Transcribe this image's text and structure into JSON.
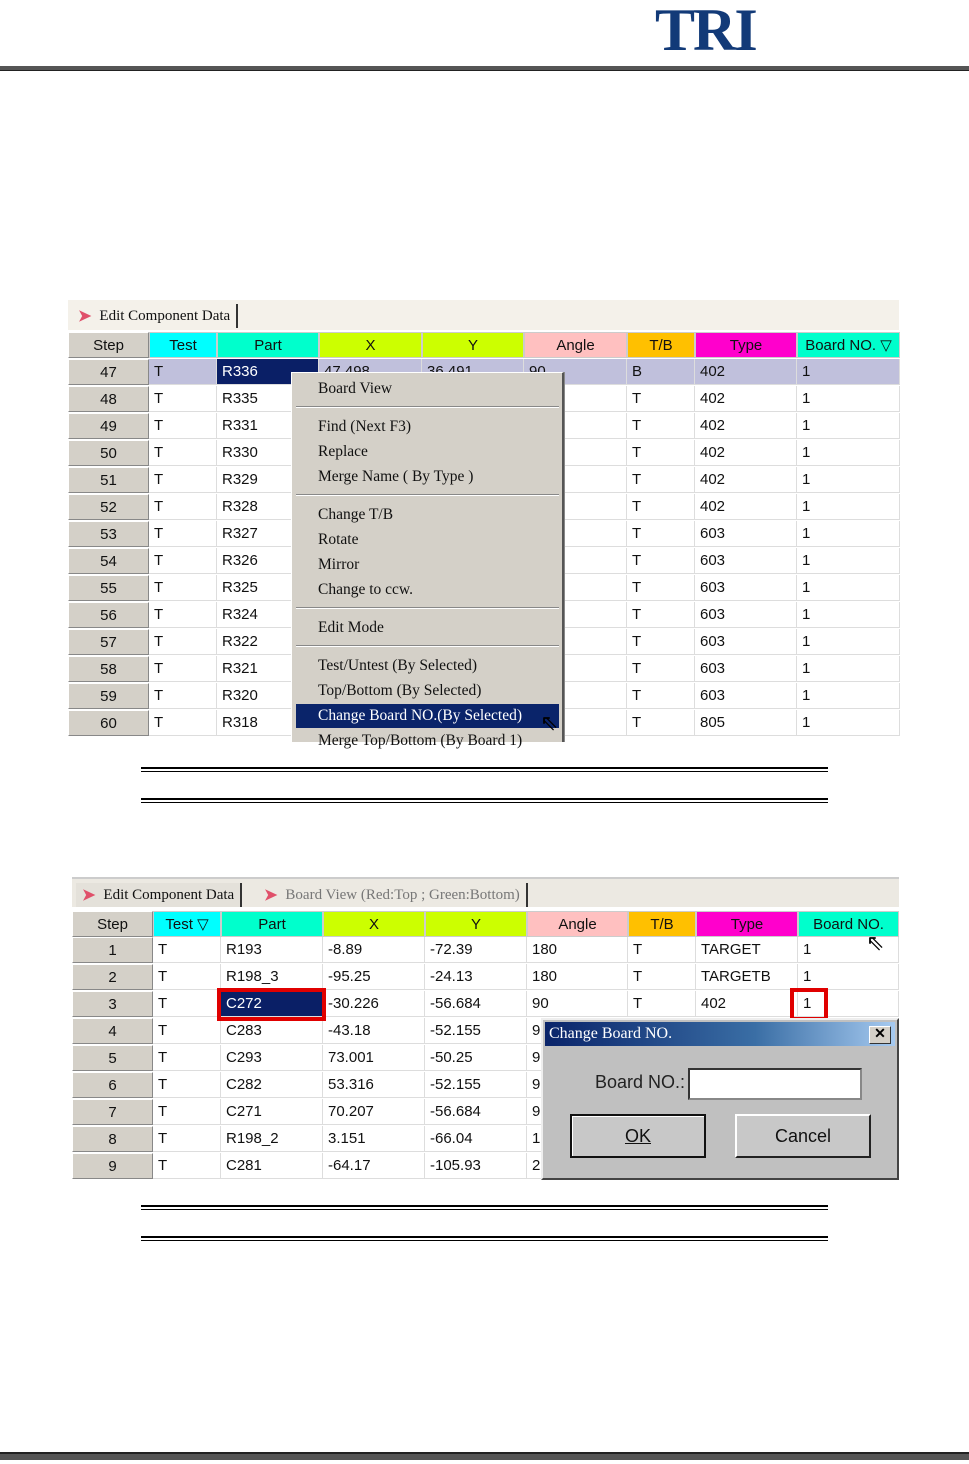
{
  "logo": "TRI",
  "table1": {
    "tabs": [
      "Edit Component Data"
    ],
    "headers": [
      "Step",
      "Test",
      "Part",
      "X",
      "Y",
      "Angle",
      "T/B",
      "Type",
      "Board NO."
    ],
    "header_colors": [
      "#d4d0c8",
      "#00ffff",
      "#00ffcc",
      "#ccff00",
      "#ccff00",
      "#ffc0c0",
      "#ffc000",
      "#ff00cc",
      "#00ffcc"
    ],
    "sort_icon": "triangle-down-icon",
    "rows": [
      [
        "47",
        "T",
        "R336",
        "47.498",
        "36.491",
        "90",
        "B",
        "402",
        "1"
      ],
      [
        "48",
        "T",
        "R335",
        "",
        "",
        "",
        "T",
        "402",
        "1"
      ],
      [
        "49",
        "T",
        "R331",
        "",
        "",
        "",
        "T",
        "402",
        "1"
      ],
      [
        "50",
        "T",
        "R330",
        "",
        "",
        "",
        "T",
        "402",
        "1"
      ],
      [
        "51",
        "T",
        "R329",
        "",
        "",
        "",
        "T",
        "402",
        "1"
      ],
      [
        "52",
        "T",
        "R328",
        "",
        "",
        "",
        "T",
        "402",
        "1"
      ],
      [
        "53",
        "T",
        "R327",
        "",
        "",
        "",
        "T",
        "603",
        "1"
      ],
      [
        "54",
        "T",
        "R326",
        "",
        "",
        "",
        "T",
        "603",
        "1"
      ],
      [
        "55",
        "T",
        "R325",
        "",
        "",
        "",
        "T",
        "603",
        "1"
      ],
      [
        "56",
        "T",
        "R324",
        "",
        "",
        "",
        "T",
        "603",
        "1"
      ],
      [
        "57",
        "T",
        "R322",
        "",
        "",
        "",
        "T",
        "603",
        "1"
      ],
      [
        "58",
        "T",
        "R321",
        "",
        "",
        "",
        "T",
        "603",
        "1"
      ],
      [
        "59",
        "T",
        "R320",
        "",
        "",
        "",
        "T",
        "603",
        "1"
      ],
      [
        "60",
        "T",
        "R318",
        "",
        "",
        "",
        "T",
        "805",
        "1"
      ]
    ],
    "context_menu": {
      "groups": [
        [
          "Board View"
        ],
        [
          "Find (Next F3)",
          "Replace",
          "Merge Name ( By Type )"
        ],
        [
          "Change T/B",
          "Rotate",
          "Mirror",
          "Change to ccw."
        ],
        [
          "Edit Mode"
        ],
        [
          "Test/Untest (By Selected)",
          "Top/Bottom (By Selected)",
          "Change Board NO.(By Selected)",
          "Merge Top/Bottom (By Board 1)"
        ]
      ],
      "highlighted": "Change Board NO.(By Selected)"
    }
  },
  "table2": {
    "tabs": [
      "Edit Component Data",
      "Board View (Red:Top ; Green:Bottom)"
    ],
    "headers": [
      "Step",
      "Test",
      "Part",
      "X",
      "Y",
      "Angle",
      "T/B",
      "Type",
      "Board NO."
    ],
    "rows": [
      [
        "1",
        "T",
        "R193",
        "-8.89",
        "-72.39",
        "180",
        "T",
        "TARGET",
        "1"
      ],
      [
        "2",
        "T",
        "R198_3",
        "-95.25",
        "-24.13",
        "180",
        "T",
        "TARGETB",
        "1"
      ],
      [
        "3",
        "T",
        "C272",
        "-30.226",
        "-56.684",
        "90",
        "T",
        "402",
        "1"
      ],
      [
        "4",
        "T",
        "C283",
        "-43.18",
        "-52.155",
        "9",
        "",
        "",
        ""
      ],
      [
        "5",
        "T",
        "C293",
        "73.001",
        "-50.25",
        "9",
        "",
        "",
        ""
      ],
      [
        "6",
        "T",
        "C282",
        "53.316",
        "-52.155",
        "9",
        "",
        "",
        ""
      ],
      [
        "7",
        "T",
        "C271",
        "70.207",
        "-56.684",
        "9",
        "",
        "",
        ""
      ],
      [
        "8",
        "T",
        "R198_2",
        "3.151",
        "-66.04",
        "1",
        "",
        "",
        ""
      ],
      [
        "9",
        "T",
        "C281",
        "-64.17",
        "-105.93",
        "2",
        "",
        "",
        ""
      ]
    ],
    "dialog": {
      "title": "Change Board NO.",
      "field_label": "Board NO.:",
      "field_value": "",
      "ok": "OK",
      "cancel": "Cancel"
    },
    "highlight_color": "#e00000"
  }
}
